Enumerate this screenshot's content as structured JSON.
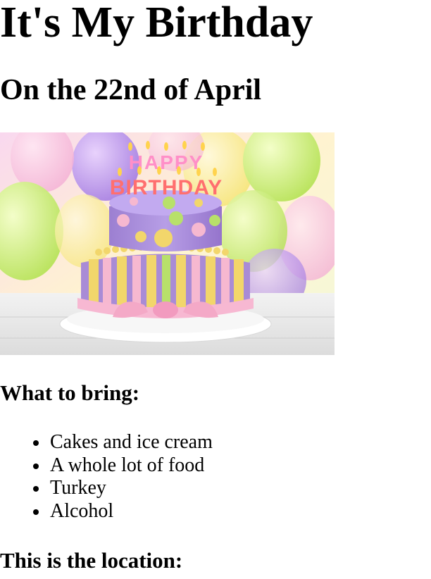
{
  "page": {
    "title": "It's My Birthday",
    "subtitle": "On the 22nd of April",
    "bring_heading": "What to bring:",
    "bring_items": [
      "Cakes and ice cream",
      "A whole lot of food",
      "Turkey",
      "Alcohol"
    ],
    "location_heading": "This is the location:"
  },
  "image": {
    "cake_topper_text": "HAPPY BIRTHDAY"
  },
  "colors": {
    "text": "#000000",
    "background": "#ffffff",
    "cake_purple": "#a98bd6",
    "cake_pink": "#f6b8d0",
    "cake_yellow": "#f2d66b",
    "cake_green": "#b8e06a"
  }
}
